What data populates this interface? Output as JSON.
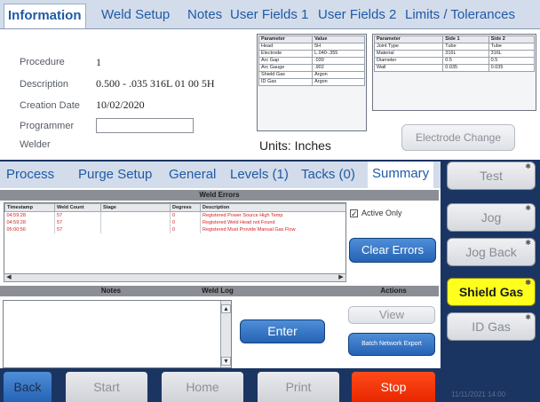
{
  "top_tabs": [
    {
      "label": "Information",
      "active": true
    },
    {
      "label": "Weld Setup"
    },
    {
      "label": "Notes"
    },
    {
      "label": "User Fields 1"
    },
    {
      "label": "User Fields 2"
    },
    {
      "label": "Limits / Tolerances"
    }
  ],
  "info": {
    "procedure_label": "Procedure",
    "procedure_value": "1",
    "description_label": "Description",
    "description_value": "0.500 - .035 316L 01 00 5H",
    "creation_date_label": "Creation Date",
    "creation_date_value": "10/02/2020",
    "programmer_label": "Programmer",
    "programmer_value": "",
    "welder_label": "Welder"
  },
  "param_table": {
    "headers": [
      "Parameter",
      "Value"
    ],
    "rows": [
      [
        "Head",
        "5H"
      ],
      [
        "Electrode",
        "L.040-.355"
      ],
      [
        "Arc Gap",
        ".030"
      ],
      [
        "Arc Gauge",
        ".902"
      ],
      [
        "Shield Gas",
        "Argon"
      ],
      [
        "ID Gas",
        "Argon"
      ]
    ]
  },
  "side_table": {
    "headers": [
      "Parameter",
      "Side 1",
      "Side 2"
    ],
    "rows": [
      [
        "Joint Type",
        "Tube",
        "Tube"
      ],
      [
        "Material",
        "316L",
        "316L"
      ],
      [
        "Diameter",
        "0.5",
        "0.5"
      ],
      [
        "Wall",
        "0.035",
        "0.035"
      ]
    ]
  },
  "units_label": "Units: Inches",
  "electrode_change_label": "Electrode Change",
  "mid_tabs": [
    {
      "label": "Process"
    },
    {
      "label": "Purge Setup"
    },
    {
      "label": "General"
    },
    {
      "label": "Levels (1)"
    },
    {
      "label": "Tacks (0)"
    },
    {
      "label": "Summary",
      "active": true
    }
  ],
  "weld_errors": {
    "title": "Weld Errors",
    "columns": [
      "Timestamp",
      "Weld Count",
      "Stage",
      "Degrees",
      "Description"
    ],
    "rows": [
      [
        "04:59:28",
        "57",
        "",
        "0",
        "Registered Power Source High Temp"
      ],
      [
        "04:59:28",
        "57",
        "",
        "0",
        "Registered Weld Head not Found"
      ],
      [
        "05:00:56",
        "57",
        "",
        "0",
        "Registered Must Provide Manual Gas Flow"
      ]
    ]
  },
  "active_only_label": "Active Only",
  "active_only_checked": true,
  "clear_errors_label": "Clear Errors",
  "lower_headers": {
    "notes": "Notes",
    "weld_log": "Weld Log",
    "actions": "Actions"
  },
  "enter_label": "Enter",
  "view_label": "View",
  "batch_export_label": "Batch Network Export",
  "side_buttons": [
    {
      "label": "Test"
    },
    {
      "label": "Jog"
    },
    {
      "label": "Jog Back"
    },
    {
      "label": "Shield Gas",
      "active": true
    },
    {
      "label": "ID Gas"
    }
  ],
  "corner_icon": "star-icon",
  "bottom_buttons": {
    "back": "Back",
    "start": "Start",
    "home": "Home",
    "print": "Print",
    "stop": "Stop"
  },
  "datetime": "11/11/2021 14:00",
  "colors": {
    "accent_blue": "#2b6cc4",
    "tab_text": "#1f5aa6",
    "stop_red": "#ff3a0a",
    "highlight_yellow": "#ffff1e",
    "error_text": "#d62020",
    "background_navy": "#1b3563"
  }
}
